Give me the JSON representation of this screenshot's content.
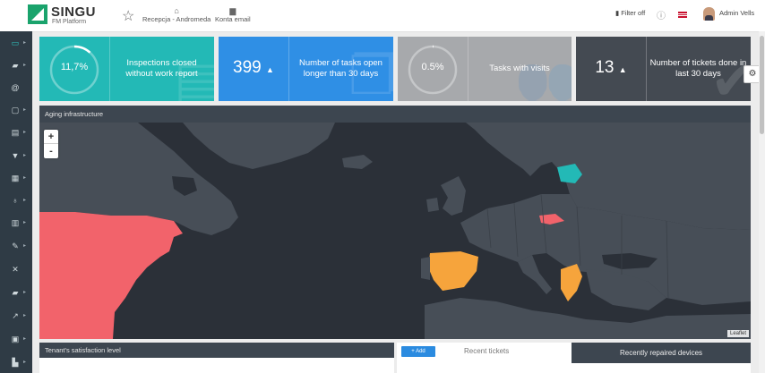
{
  "header": {
    "logo_name": "SINGU",
    "logo_sub": "FM Platform",
    "nav": [
      {
        "label": "Recepcja - Andromeda",
        "icon": "home-icon"
      },
      {
        "label": "Konta email",
        "icon": "briefcase-icon"
      }
    ],
    "filter_label": "Filter off",
    "user_name": "Admin Vells"
  },
  "sidebar": {
    "items": [
      {
        "icon": "monitor-icon"
      },
      {
        "icon": "truck-icon"
      },
      {
        "icon": "at-icon"
      },
      {
        "icon": "document-icon"
      },
      {
        "icon": "report-icon"
      },
      {
        "icon": "filter-icon"
      },
      {
        "icon": "calendar-icon"
      },
      {
        "icon": "lightbulb-icon"
      },
      {
        "icon": "bank-icon"
      },
      {
        "icon": "wrench-icon"
      },
      {
        "icon": "tools-icon"
      },
      {
        "icon": "delivery-icon"
      },
      {
        "icon": "chart-icon"
      },
      {
        "icon": "money-icon"
      },
      {
        "icon": "stats-icon"
      }
    ]
  },
  "cards": [
    {
      "value": "11,7%",
      "progress": 0.117,
      "label": "Inspections closed without work report",
      "color": "#23b9b6"
    },
    {
      "value": "399",
      "label": "Number of tasks open longer than 30 days",
      "color": "#2f8fe5"
    },
    {
      "value": "0.5%",
      "progress": 0.005,
      "label": "Tasks with visits",
      "color": "#a7a9ac"
    },
    {
      "value": "13",
      "label": "Number of tickets done in last 30 days",
      "color": "#444a52"
    }
  ],
  "map": {
    "title": "Aging infrastructure",
    "zoom_in": "+",
    "zoom_out": "-",
    "attribution": "Leaflet",
    "colors": {
      "sea": "#2b3038",
      "land": "#474e57",
      "red": "#f2636b",
      "orange": "#f6a43c",
      "teal": "#23b9b6"
    }
  },
  "bottom": {
    "satisfaction_title": "Tenant's satisfaction level",
    "add_label": "+ Add",
    "recent_tickets": "Recent tickets",
    "recently_repaired": "Recently repaired devices"
  }
}
